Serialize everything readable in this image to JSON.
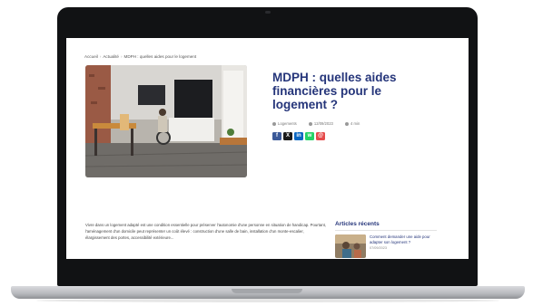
{
  "breadcrumb": {
    "home": "Accueil",
    "category": "Actualité",
    "current": "MDPH : quelles aides pour le logement"
  },
  "article": {
    "title": "MDPH : quelles aides financières pour le logement ?",
    "author": "Logements",
    "date": "12/09/2023",
    "read_time": "4 min",
    "intro": "Vivre dans un logement adapté est une condition essentielle pour préserver l'autonomie d'une personne en situation de handicap. Pourtant, l'aménagement d'un domicile peut représenter un coût élevé : construction d'une salle de bain, installation d'un monte-escalier, élargissement des portes, accessibilité extérieure..."
  },
  "share_buttons": [
    {
      "icon": "facebook-icon",
      "glyph": "f",
      "color": "#3b5998"
    },
    {
      "icon": "x-icon",
      "glyph": "X",
      "color": "#1a1a1a"
    },
    {
      "icon": "linkedin-icon",
      "glyph": "in",
      "color": "#0a66c2"
    },
    {
      "icon": "whatsapp-icon",
      "glyph": "w",
      "color": "#25d366"
    },
    {
      "icon": "email-icon",
      "glyph": "@",
      "color": "#e54b4b"
    }
  ],
  "sidebar": {
    "title": "Articles récents",
    "recent": [
      {
        "title": "Comment demander une aide pour adapter son logement ?",
        "date": "07/09/2023"
      }
    ]
  },
  "colors": {
    "title_blue": "#25357a",
    "laptop_bezel": "#111214"
  }
}
